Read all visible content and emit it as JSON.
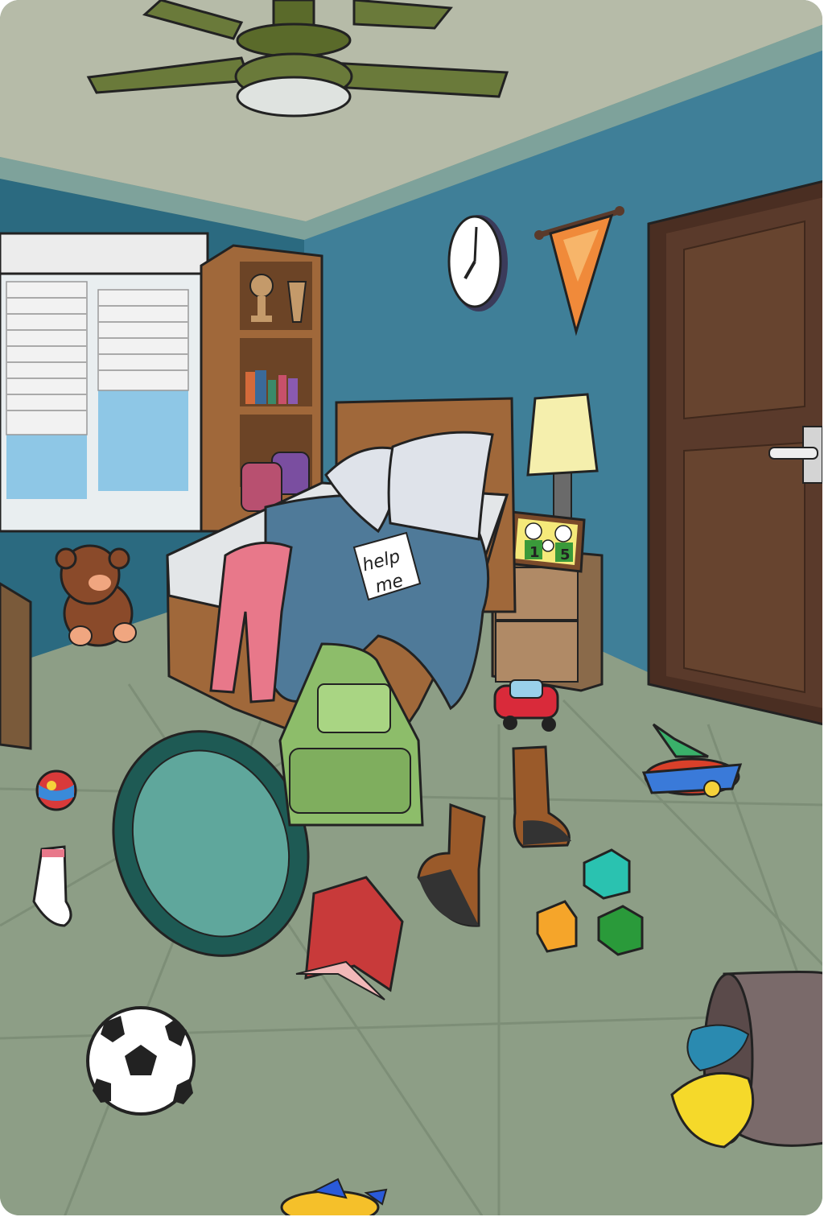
{
  "scene": {
    "note": {
      "line1": "help",
      "line2": "me"
    },
    "photo_frame": {
      "left_number": "1",
      "right_number": "5"
    }
  },
  "colors": {
    "ceiling": "#b6bba8",
    "wall": "#3f7f98",
    "wall_dark": "#2b6a80",
    "floor": "#8d9e86",
    "door": "#5a3a2b",
    "wood": "#a0683a",
    "bed_blanket": "#4f7a99",
    "backpack_green": "#8dbd6a",
    "rug": "#3c8c83",
    "book_red": "#c83a3a"
  },
  "icons": [
    "ceiling-fan-icon",
    "clock-icon",
    "pennant-icon",
    "door-icon",
    "window-icon",
    "bookshelf-icon",
    "bed-icon",
    "lamp-icon",
    "teddy-bear-icon",
    "ball-icon",
    "sock-icon",
    "rug-icon",
    "backpack-icon",
    "boot-icon",
    "toy-car-icon",
    "toy-plane-icon",
    "block-icon",
    "soccer-ball-icon",
    "laundry-basket-icon",
    "book-icon"
  ]
}
